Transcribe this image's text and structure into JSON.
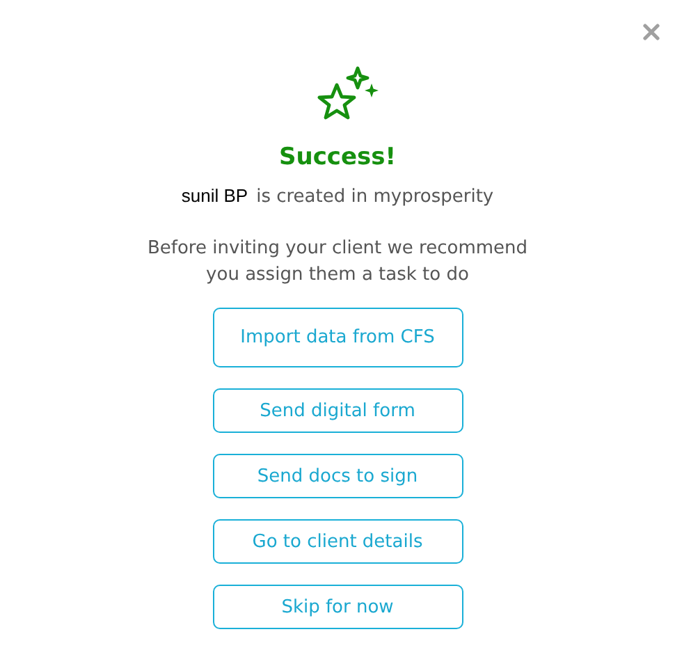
{
  "dialog": {
    "title": "Success!",
    "client_name": "sunil BP",
    "created_text": "is created in myprosperity",
    "message": "Before inviting your client we recommend you assign them a task to do",
    "actions": [
      {
        "label": "Import data from CFS",
        "kind": "tall"
      },
      {
        "label": "Send digital form",
        "kind": "normal"
      },
      {
        "label": "Send docs to sign",
        "kind": "normal"
      },
      {
        "label": "Go to client details",
        "kind": "normal"
      },
      {
        "label": "Skip for now",
        "kind": "normal"
      }
    ]
  }
}
